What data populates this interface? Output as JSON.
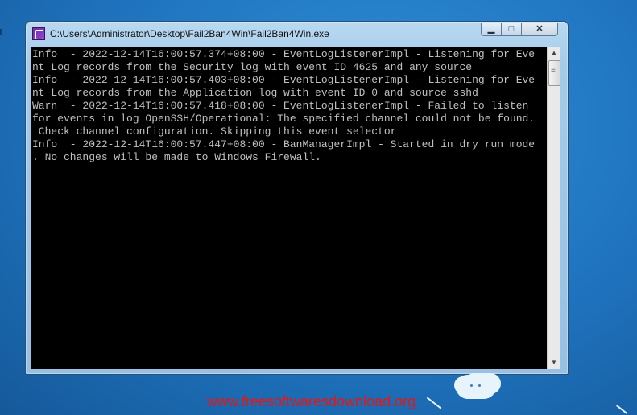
{
  "window": {
    "title": "C:\\Users\\Administrator\\Desktop\\Fail2Ban4Win\\Fail2Ban4Win.exe",
    "controls": {
      "minimize": "▁",
      "maximize": "□",
      "close": "✕"
    }
  },
  "console": {
    "lines": [
      "Info  - 2022-12-14T16:00:57.374+08:00 - EventLogListenerImpl - Listening for Eve",
      "nt Log records from the Security log with event ID 4625 and any source",
      "Info  - 2022-12-14T16:00:57.403+08:00 - EventLogListenerImpl - Listening for Eve",
      "nt Log records from the Application log with event ID 0 and source sshd",
      "Warn  - 2022-12-14T16:00:57.418+08:00 - EventLogListenerImpl - Failed to listen",
      "for events in log OpenSSH/Operational: The specified channel could not be found.",
      " Check channel configuration. Skipping this event selector",
      "Info  - 2022-12-14T16:00:57.447+08:00 - BanManagerImpl - Started in dry run mode",
      ". No changes will be made to Windows Firewall."
    ]
  },
  "scrollbar": {
    "up": "▲",
    "down": "▼"
  },
  "watermark": "www.freesoftwaresdownload.org",
  "colors": {
    "console_bg": "#000000",
    "console_fg": "#c0c0c0",
    "watermark": "#e21818"
  }
}
